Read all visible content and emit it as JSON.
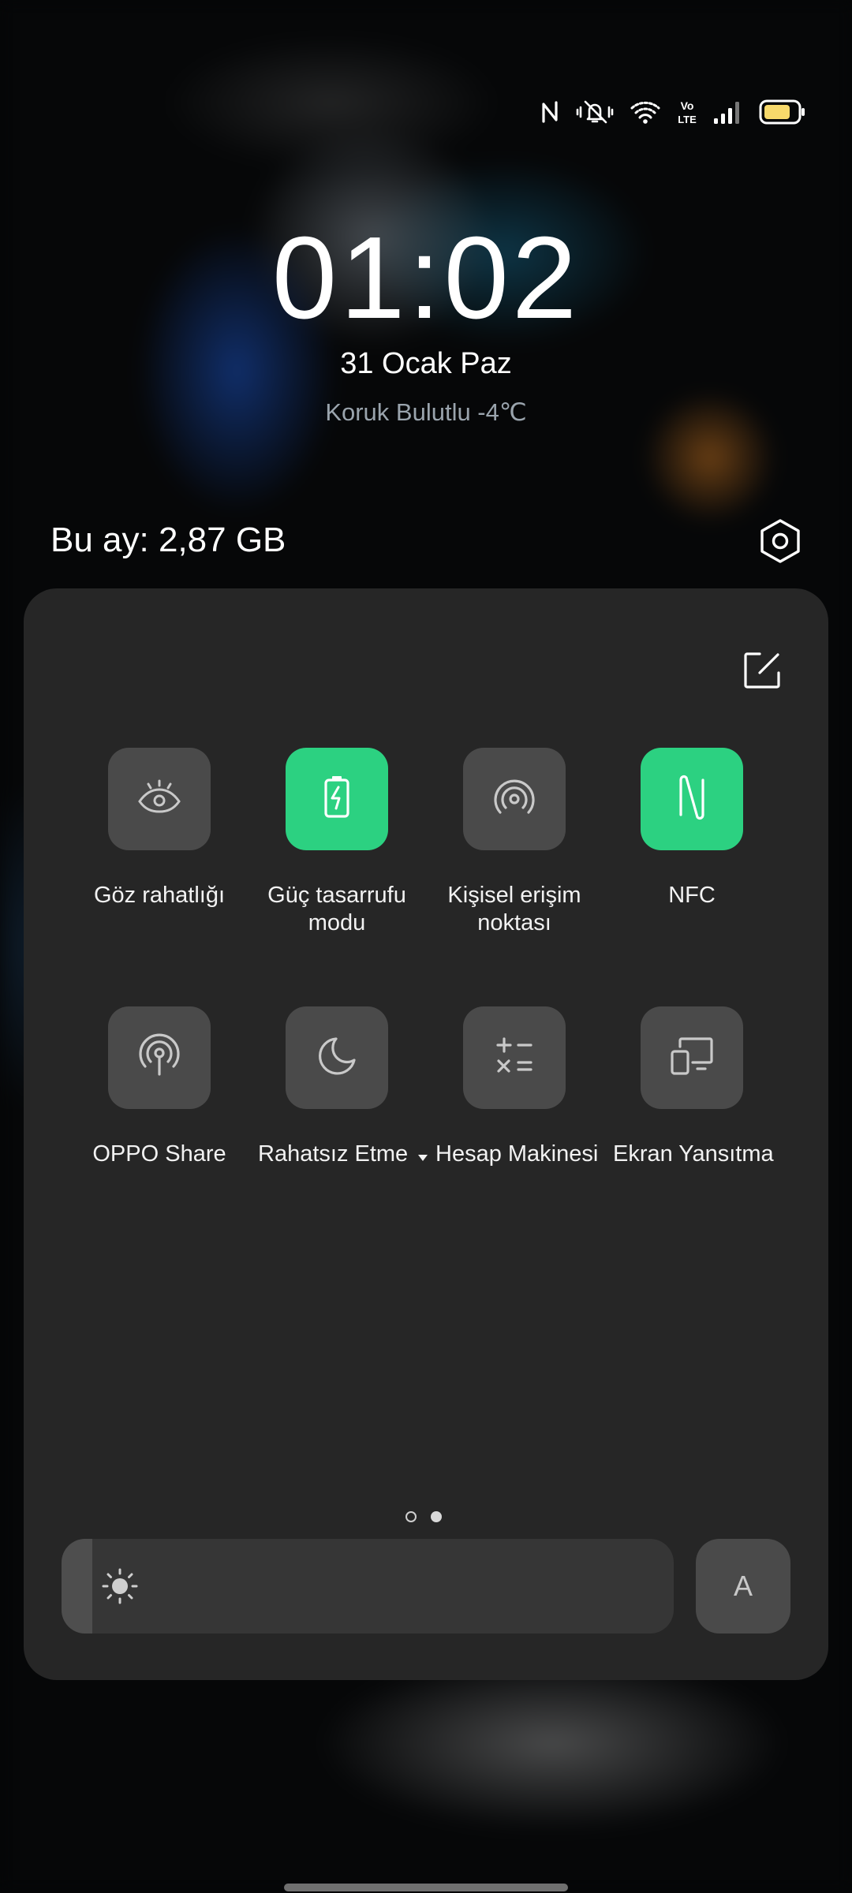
{
  "status_bar": {
    "icons": [
      "nfc-icon",
      "vibrate-silent-icon",
      "wifi-icon",
      "volte-icon",
      "signal-icon",
      "battery-icon"
    ],
    "volte_text": "Vo\nLTE",
    "battery_color": "#f7d96b"
  },
  "lockscreen": {
    "time": "01:02",
    "date": "31 Ocak Paz",
    "weather": "Koruk Bulutlu -4℃"
  },
  "data_usage": {
    "label": "Bu ay: 2,87 GB"
  },
  "panel": {
    "edit_icon": "edit-icon",
    "settings_icon": "settings-icon",
    "tiles": [
      {
        "label": "Göz rahatlığı",
        "icon": "eye-icon",
        "active": false
      },
      {
        "label": "Güç tasarrufu modu",
        "icon": "battery-saver-icon",
        "active": true
      },
      {
        "label": "Kişisel erişim noktası",
        "icon": "hotspot-icon",
        "active": false
      },
      {
        "label": "NFC",
        "icon": "nfc-icon",
        "active": true
      },
      {
        "label": "OPPO Share",
        "icon": "oppo-share-icon",
        "active": false
      },
      {
        "label": "Rahatsız Etme",
        "icon": "moon-icon",
        "active": false,
        "has_dropdown": true
      },
      {
        "label": "Hesap Makinesi",
        "icon": "calculator-icon",
        "active": false
      },
      {
        "label": "Ekran Yansıtma",
        "icon": "screen-cast-icon",
        "active": false
      }
    ],
    "page_indicator": {
      "pages": 2,
      "current": 2
    },
    "brightness": {
      "level": 0.05,
      "icon": "sun-icon"
    },
    "auto_brightness_label": "A"
  },
  "colors": {
    "accent": "#2cd181",
    "panel_bg": "#262626",
    "tile_bg": "#4a4a4a"
  }
}
